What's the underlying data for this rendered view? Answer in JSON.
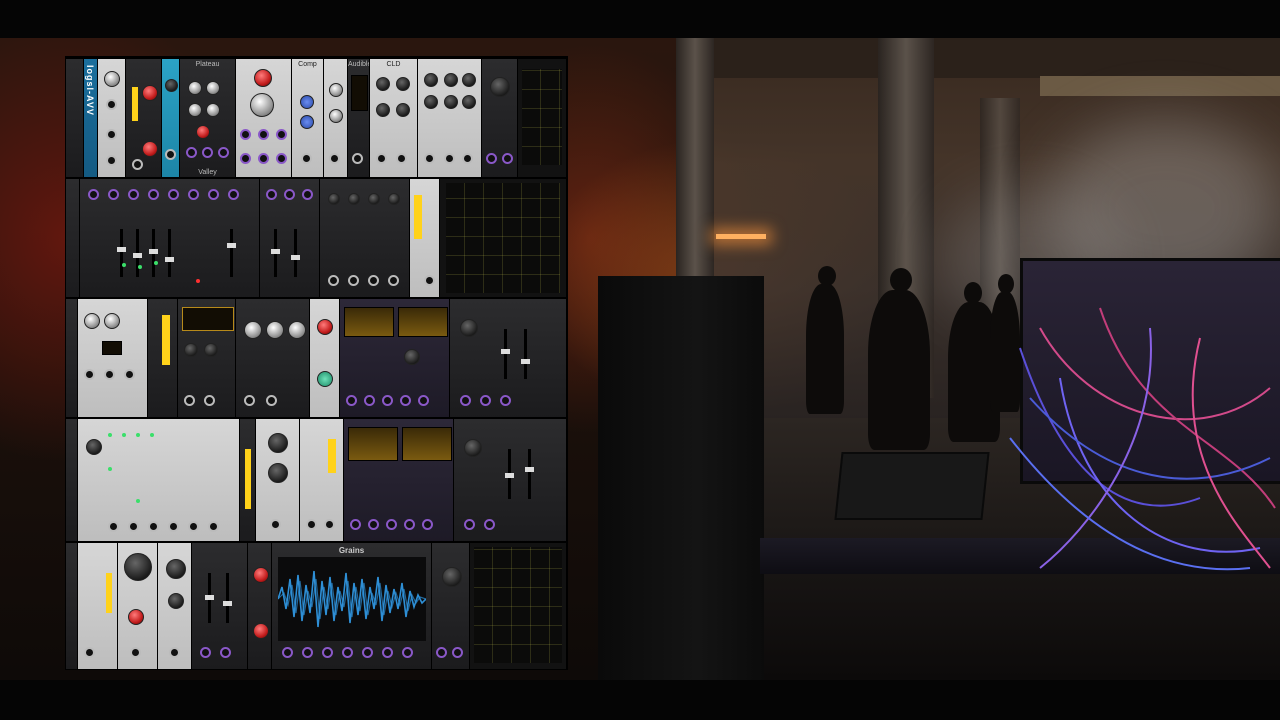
{
  "video": {
    "letterbox": true
  },
  "rack": {
    "modules": {
      "plateau_label": "Plateau",
      "valley_label": "Valley",
      "comp_label": "Comp",
      "audible_label": "Audible",
      "clouds_label": "CLD",
      "grains_title": "Grains",
      "vertical_brand": "Iogsl-AVV"
    },
    "colors": {
      "accent_yellow": "#ffd21a",
      "jack_purple": "#8a58c8",
      "wave_blue": "#2e8fd6"
    }
  },
  "background": {
    "scene": "warehouse party with modular synthesizer"
  }
}
